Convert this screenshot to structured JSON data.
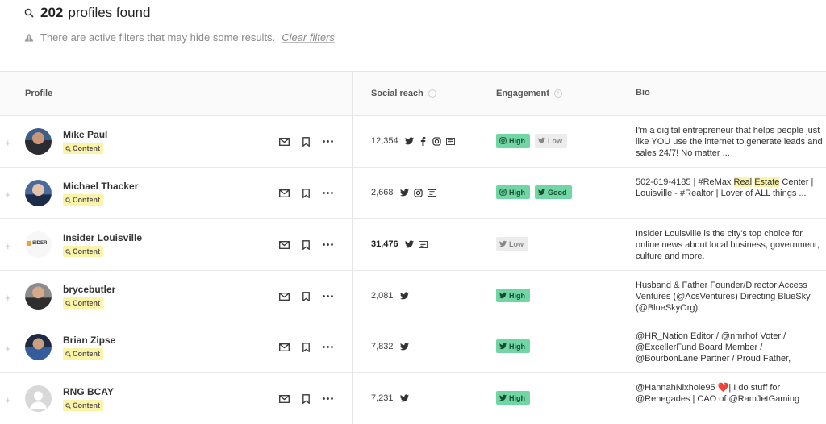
{
  "search": {
    "count": "202",
    "found_text": "profiles found"
  },
  "notice": {
    "text": "There are active filters that may hide some results.",
    "clear_link": "Clear filters"
  },
  "columns": {
    "profile": "Profile",
    "social_reach": "Social reach",
    "engagement": "Engagement",
    "bio": "Bio"
  },
  "tag_label": "Content",
  "rows": [
    {
      "name": "Mike Paul",
      "reach": "12,354",
      "reach_bold": false,
      "networks": [
        "twitter-icon",
        "facebook-icon",
        "instagram-icon",
        "blog-icon"
      ],
      "engagement": [
        {
          "icon": "instagram-icon",
          "label": "High",
          "level": "high"
        },
        {
          "icon": "twitter-icon",
          "label": "Low",
          "level": "low"
        }
      ],
      "bio": "I'm a digital entrepreneur that helps people just like YOU use the internet to generate leads and sales 24/7! No matter ..."
    },
    {
      "name": "Michael Thacker",
      "reach": "2,668",
      "reach_bold": false,
      "networks": [
        "twitter-icon",
        "instagram-icon",
        "blog-icon"
      ],
      "engagement": [
        {
          "icon": "instagram-icon",
          "label": "High",
          "level": "high"
        },
        {
          "icon": "twitter-icon",
          "label": "Good",
          "level": "good"
        }
      ],
      "bio_parts": [
        "502-619-4185 | #ReMax ",
        "Real",
        " ",
        "Estate",
        " Center | Louisville - #Realtor | Lover of ALL things ..."
      ]
    },
    {
      "name": "Insider Louisville",
      "reach": "31,476",
      "reach_bold": true,
      "networks": [
        "twitter-icon",
        "blog-icon"
      ],
      "engagement": [
        {
          "icon": "twitter-icon",
          "label": "Low",
          "level": "low"
        }
      ],
      "bio": "Insider Louisville is the city's top choice for online news about local business, government, culture and more."
    },
    {
      "name": "brycebutler",
      "reach": "2,081",
      "reach_bold": false,
      "networks": [
        "twitter-icon"
      ],
      "engagement": [
        {
          "icon": "twitter-icon",
          "label": "High",
          "level": "high"
        }
      ],
      "bio": "Husband & Father Founder/Director Access Ventures (@AcsVentures) Directing BlueSky (@BlueSkyOrg)"
    },
    {
      "name": "Brian Zipse",
      "reach": "7,832",
      "reach_bold": false,
      "networks": [
        "twitter-icon"
      ],
      "engagement": [
        {
          "icon": "twitter-icon",
          "label": "High",
          "level": "high"
        }
      ],
      "bio": "@HR_Nation Editor / @nmrhof Voter / @ExcellerFund Board Member / @BourbonLane Partner / Proud Father,"
    },
    {
      "name": "RNG BCAY",
      "reach": "7,231",
      "reach_bold": false,
      "networks": [
        "twitter-icon"
      ],
      "engagement": [
        {
          "icon": "twitter-icon",
          "label": "High",
          "level": "high"
        }
      ],
      "bio_parts": [
        "@HannahNixhole95 ",
        "❤️",
        "| I do stuff for @Renegades | CAO of @RamJetGaming"
      ]
    }
  ],
  "colors": {
    "tag_bg": "#fbf3a8",
    "high_bg": "#6fd6a4",
    "low_bg": "#ececec"
  }
}
